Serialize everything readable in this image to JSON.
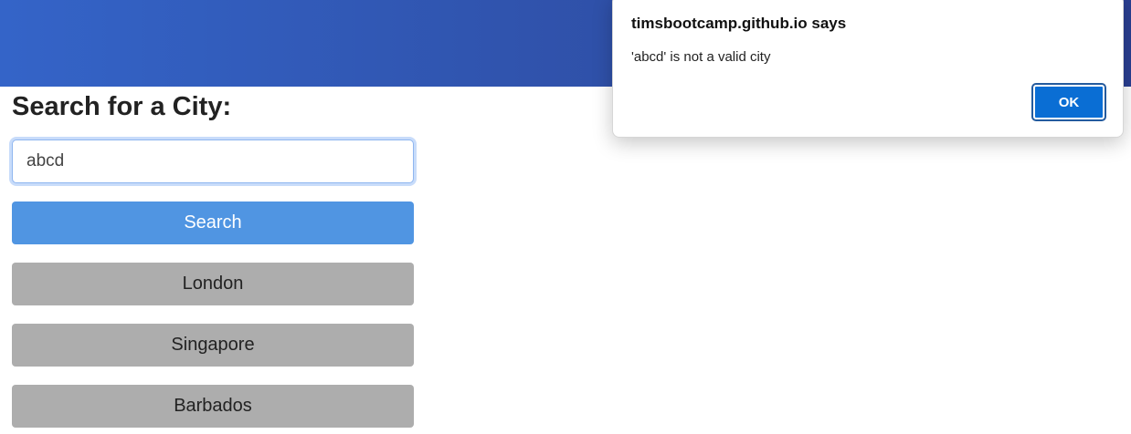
{
  "search": {
    "title": "Search for a City:",
    "input_value": "abcd",
    "button_label": "Search"
  },
  "history": {
    "cities": [
      "London",
      "Singapore",
      "Barbados"
    ]
  },
  "alert": {
    "title": "timsbootcamp.github.io says",
    "message": "'abcd' is not a valid city",
    "ok_label": "OK"
  },
  "colors": {
    "header_start": "#3464c8",
    "header_end": "#2a3f92",
    "search_button": "#5095e2",
    "city_button": "#adadad",
    "ok_button": "#0a6ed4"
  }
}
